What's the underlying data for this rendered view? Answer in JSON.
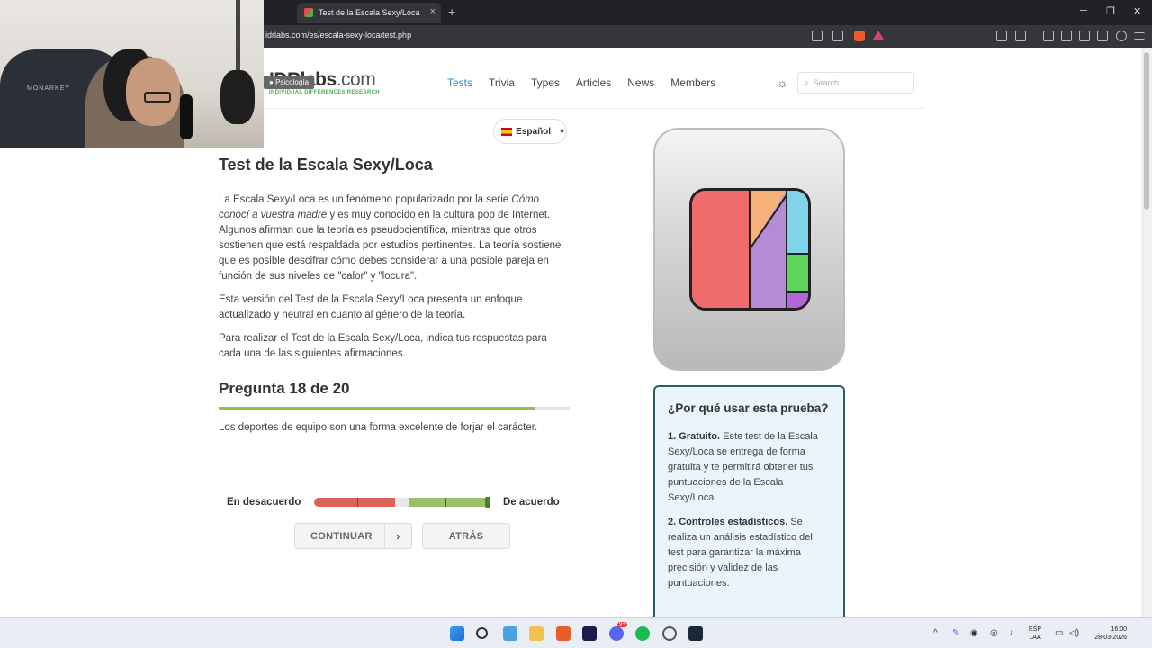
{
  "browser": {
    "tab_title": "Test de la Escala Sexy/Loca",
    "url": "idrlabs.com/es/escala-sexy-loca/test.php",
    "new_tab": "+",
    "tab_close": "×",
    "window_controls": [
      "─",
      "❐",
      "✕"
    ]
  },
  "webcam": {
    "chair_brand": "MONARKEY"
  },
  "site": {
    "logo_main": "IDRlabs",
    "logo_suffix": ".com",
    "logo_sub": "INDIVIDUAL DIFFERENCES RESEARCH",
    "nav": [
      "Tests",
      "Trivia",
      "Types",
      "Articles",
      "News",
      "Members"
    ],
    "active_nav": "Tests",
    "search_placeholder": "Search..."
  },
  "category_tag": "Psicología",
  "language": "Español",
  "article": {
    "title": "Test de la Escala Sexy/Loca",
    "p1_a": "La Escala Sexy/Loca es un fenómeno popularizado por la serie ",
    "p1_em": "Cómo conocí a vuestra madre",
    "p1_b": " y es muy conocido en la cultura pop de Internet. Algunos afirman que la teoría es pseudocientífica, mientras que otros sostienen que está respaldada por estudios pertinentes. La teoría sostiene que es posible descifrar cómo debes considerar a una posible pareja en función de sus niveles de \"calor\" y \"locura\".",
    "p2": "Esta versión del Test de la Escala Sexy/Loca presenta un enfoque actualizado y neutral en cuanto al género de la teoría.",
    "p3": "Para realizar el Test de la Escala Sexy/Loca, indica tus respuestas para cada una de las siguientes afirmaciones.",
    "question_heading": "Pregunta 18 de 20",
    "progress": 0.9,
    "question": "Los deportes de equipo son una forma excelente de forjar el carácter.",
    "scale_left": "En desacuerdo",
    "scale_right": "De acuerdo",
    "slider_value": 1.0,
    "continue_label": "CONTINUAR",
    "back_label": "ATRÁS"
  },
  "why": {
    "title": "¿Por qué usar esta prueba?",
    "item1_title": "1. Gratuito.",
    "item1_text": " Este test de la Escala Sexy/Loca se entrega de forma gratuita y te permitirá obtener tus puntuaciones de la Escala Sexy/Loca.",
    "item2_title": "2. Controles estadísticos.",
    "item2_text": " Se realiza un análisis estadístico del test para garantizar la máxima precisión y validez de las puntuaciones."
  },
  "taskbar": {
    "lang_top": "ESP",
    "lang_bottom": "LAA",
    "time": "16:00",
    "date": "28-03-2026",
    "discord_badge": "9+"
  },
  "colors": {
    "accent": "#2a8ec5",
    "progress": "#8bc34a",
    "slider_disagree": "#d9635a",
    "slider_agree": "#9bc06a",
    "why_border": "#2f5d66",
    "why_bg": "#eaf5fb"
  }
}
